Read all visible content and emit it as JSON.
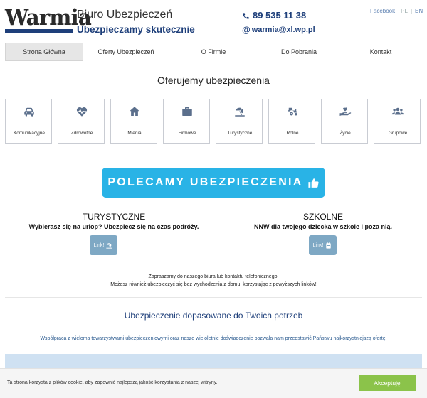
{
  "header": {
    "logo_text": "Warmia",
    "brand_title": "Biuro Ubezpieczeń",
    "brand_subtitle": "Ubezpieczamy skutecznie",
    "phone": "89 535 11 38",
    "email": "warmia@xl.wp.pl",
    "facebook": "Facebook",
    "lang_pl": "PL",
    "lang_sep": "|",
    "lang_en": "EN"
  },
  "nav": {
    "items": [
      {
        "label": "Strona Główna",
        "active": true
      },
      {
        "label": "Oferty Ubezpieczeń"
      },
      {
        "label": "O Firmie"
      },
      {
        "label": "Do Pobrania"
      },
      {
        "label": "Kontakt"
      }
    ]
  },
  "offer": {
    "heading": "Oferujemy ubezpieczenia",
    "tiles": [
      {
        "label": "Komunikacyjne",
        "icon": "car-icon"
      },
      {
        "label": "Zdrowotne",
        "icon": "heartbeat-icon"
      },
      {
        "label": "Mienia",
        "icon": "home-icon"
      },
      {
        "label": "Firmowe",
        "icon": "briefcase-icon"
      },
      {
        "label": "Turystyczne",
        "icon": "beach-umbrella-icon"
      },
      {
        "label": "Rolne",
        "icon": "tractor-icon"
      },
      {
        "label": "Życie",
        "icon": "hand-heart-icon"
      },
      {
        "label": "Grupowe",
        "icon": "users-icon"
      }
    ]
  },
  "banner": {
    "text": "POLECAMY UBEZPIECZENIA"
  },
  "promos": {
    "tourist": {
      "title": "TURYSTYCZNE",
      "desc": "Wybierasz się na urlop? Ubezpiecz się na czas podróży.",
      "link": "Link!"
    },
    "school": {
      "title": "SZKOLNE",
      "desc": "NNW dla twojego dziecka w szkole i poza nią.",
      "link": "Link!"
    }
  },
  "invite": {
    "line1": "Zapraszamy do naszego biura lub kontaktu telefonicznego.",
    "line2": "Możesz również ubezpieczyć się bez wychodzenia z domu, korzystając z powyższych linków!"
  },
  "fit": {
    "heading": "Ubezpieczenie dopasowane do Twoich potrzeb",
    "text": "Współpraca z wieloma towarzystwami ubezpieczeniowymi oraz nasze wieloletnie doświadczenie pozwala nam przedstawić Państwu najkorzystniejszą ofertę."
  },
  "cookie": {
    "text": "Ta strona korzysta z plików cookie, aby zapewnić najlepszą jakość korzystania z naszej witryny.",
    "accept": "Akceptuję"
  },
  "colors": {
    "navy": "#1e3f7a",
    "sky": "#29b3e6",
    "icon": "#5b6f8c",
    "link_btn": "#7ea8c4",
    "accept": "#8bc34a"
  }
}
